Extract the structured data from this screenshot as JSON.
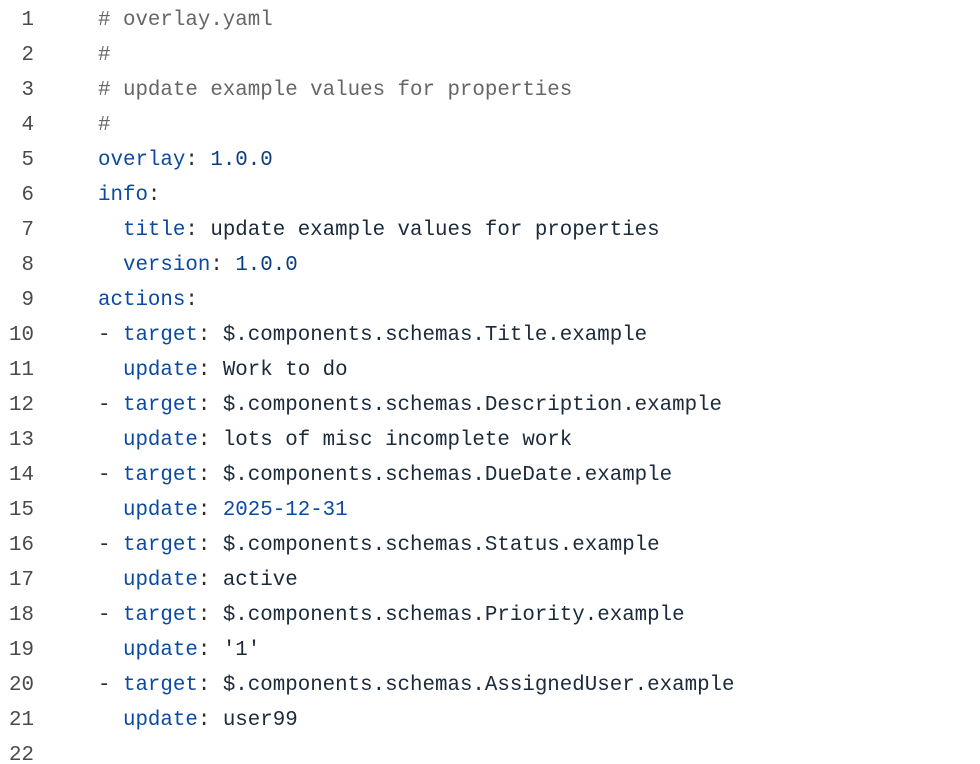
{
  "file": {
    "lines": [
      {
        "n": "1",
        "indent": "",
        "dash": "",
        "comment": "# overlay.yaml",
        "key": "",
        "sep": "",
        "value": "",
        "vclass": ""
      },
      {
        "n": "2",
        "indent": "",
        "dash": "",
        "comment": "#",
        "key": "",
        "sep": "",
        "value": "",
        "vclass": ""
      },
      {
        "n": "3",
        "indent": "",
        "dash": "",
        "comment": "# update example values for properties",
        "key": "",
        "sep": "",
        "value": "",
        "vclass": ""
      },
      {
        "n": "4",
        "indent": "",
        "dash": "",
        "comment": "#",
        "key": "",
        "sep": "",
        "value": "",
        "vclass": ""
      },
      {
        "n": "5",
        "indent": "",
        "dash": "",
        "comment": "",
        "key": "overlay",
        "sep": ": ",
        "value": "1.0.0",
        "vclass": "c-num"
      },
      {
        "n": "6",
        "indent": "",
        "dash": "",
        "comment": "",
        "key": "info",
        "sep": ":",
        "value": "",
        "vclass": ""
      },
      {
        "n": "7",
        "indent": "  ",
        "dash": "",
        "comment": "",
        "key": "title",
        "sep": ": ",
        "value": "update example values for properties",
        "vclass": "c-val"
      },
      {
        "n": "8",
        "indent": "  ",
        "dash": "",
        "comment": "",
        "key": "version",
        "sep": ": ",
        "value": "1.0.0",
        "vclass": "c-num"
      },
      {
        "n": "9",
        "indent": "",
        "dash": "",
        "comment": "",
        "key": "actions",
        "sep": ":",
        "value": "",
        "vclass": ""
      },
      {
        "n": "10",
        "indent": "",
        "dash": "- ",
        "comment": "",
        "key": "target",
        "sep": ": ",
        "value": "$.components.schemas.Title.example",
        "vclass": "c-val"
      },
      {
        "n": "11",
        "indent": "  ",
        "dash": "",
        "comment": "",
        "key": "update",
        "sep": ": ",
        "value": "Work to do",
        "vclass": "c-val"
      },
      {
        "n": "12",
        "indent": "",
        "dash": "- ",
        "comment": "",
        "key": "target",
        "sep": ": ",
        "value": "$.components.schemas.Description.example",
        "vclass": "c-val"
      },
      {
        "n": "13",
        "indent": "  ",
        "dash": "",
        "comment": "",
        "key": "update",
        "sep": ": ",
        "value": "lots of misc incomplete work",
        "vclass": "c-val"
      },
      {
        "n": "14",
        "indent": "",
        "dash": "- ",
        "comment": "",
        "key": "target",
        "sep": ": ",
        "value": "$.components.schemas.DueDate.example",
        "vclass": "c-val"
      },
      {
        "n": "15",
        "indent": "  ",
        "dash": "",
        "comment": "",
        "key": "update",
        "sep": ": ",
        "value": "2025-12-31",
        "vclass": "c-date"
      },
      {
        "n": "16",
        "indent": "",
        "dash": "- ",
        "comment": "",
        "key": "target",
        "sep": ": ",
        "value": "$.components.schemas.Status.example",
        "vclass": "c-val"
      },
      {
        "n": "17",
        "indent": "  ",
        "dash": "",
        "comment": "",
        "key": "update",
        "sep": ": ",
        "value": "active",
        "vclass": "c-val"
      },
      {
        "n": "18",
        "indent": "",
        "dash": "- ",
        "comment": "",
        "key": "target",
        "sep": ": ",
        "value": "$.components.schemas.Priority.example",
        "vclass": "c-val"
      },
      {
        "n": "19",
        "indent": "  ",
        "dash": "",
        "comment": "",
        "key": "update",
        "sep": ": ",
        "value": "'1'",
        "vclass": "c-str"
      },
      {
        "n": "20",
        "indent": "",
        "dash": "- ",
        "comment": "",
        "key": "target",
        "sep": ": ",
        "value": "$.components.schemas.AssignedUser.example",
        "vclass": "c-val"
      },
      {
        "n": "21",
        "indent": "  ",
        "dash": "",
        "comment": "",
        "key": "update",
        "sep": ": ",
        "value": "user99",
        "vclass": "c-val"
      },
      {
        "n": "22",
        "indent": "",
        "dash": "",
        "comment": "",
        "key": "",
        "sep": "",
        "value": "",
        "vclass": ""
      }
    ]
  },
  "colors": {
    "key": "#0b4aa2",
    "comment": "#666666",
    "line_number": "#4a4a4a",
    "value": "#1b2a3a"
  }
}
